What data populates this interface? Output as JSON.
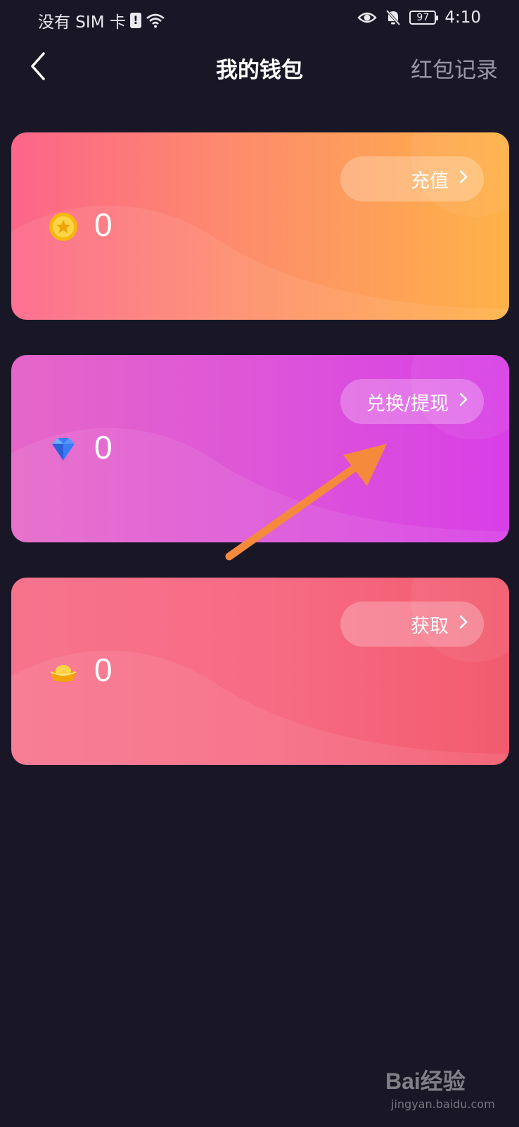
{
  "status_bar": {
    "carrier": "没有 SIM 卡",
    "sim_alert": "!",
    "battery": "97",
    "time": "4:10",
    "icons": [
      "wifi-icon",
      "eye-icon",
      "bell-off-icon",
      "battery-icon"
    ]
  },
  "header": {
    "title": "我的钱包",
    "right_link": "红包记录",
    "back_icon": "chevron-left-icon"
  },
  "cards": [
    {
      "icon": "gold-coin-icon",
      "value": "0",
      "button_label": "充值",
      "button_icon": "chevron-right-icon"
    },
    {
      "icon": "diamond-icon",
      "value": "0",
      "button_label": "兑换/提现",
      "button_icon": "chevron-right-icon"
    },
    {
      "icon": "gold-ingot-icon",
      "value": "0",
      "button_label": "获取",
      "button_icon": "chevron-right-icon"
    }
  ],
  "annotation": {
    "arrow_color": "#f58a3c"
  },
  "watermark": {
    "main": "Bai经验",
    "sub": "jingyan.baidu.com"
  },
  "colors": {
    "background": "#191726",
    "card1": [
      "#fc6589",
      "#feb247"
    ],
    "card2": [
      "#e566c8",
      "#d83fe6"
    ],
    "card3": [
      "#f7738d",
      "#f25b6e"
    ],
    "link_gray": "#9a98a6"
  }
}
